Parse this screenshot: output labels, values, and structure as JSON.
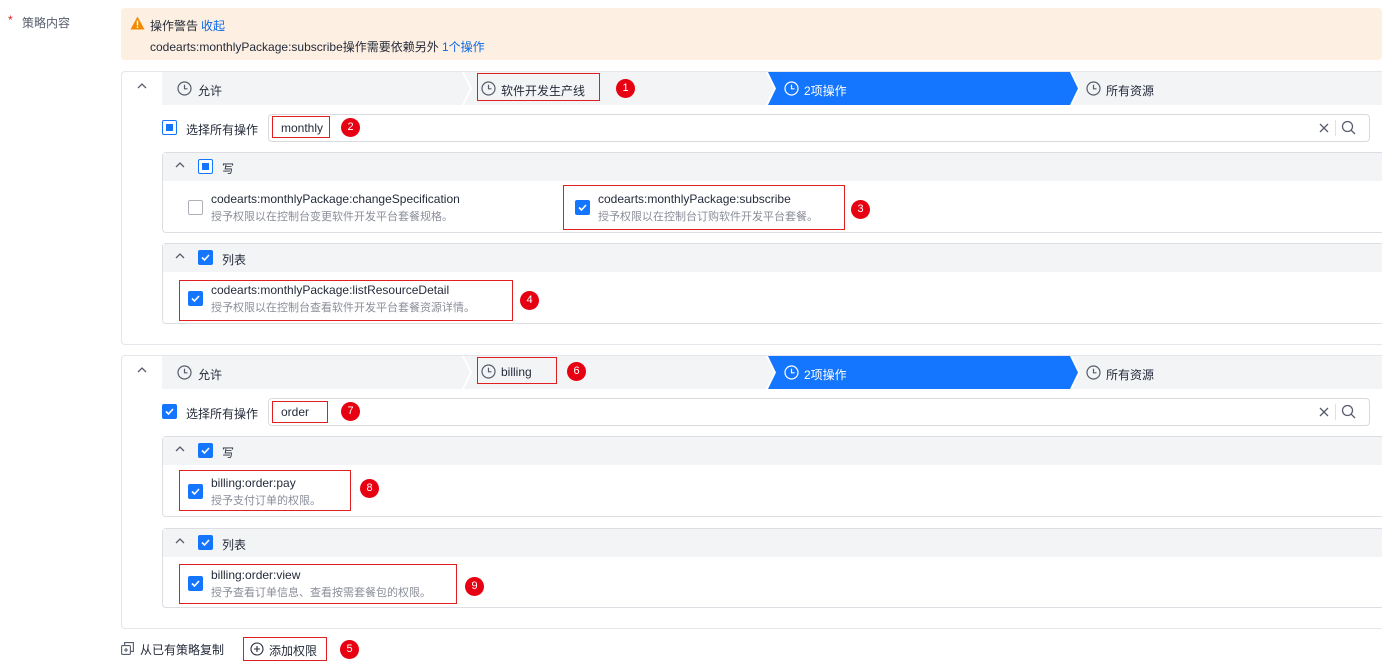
{
  "field": {
    "required_mark": "*",
    "label": "策略内容"
  },
  "warning": {
    "title": "操作警告",
    "collapse_label": "收起",
    "message": "codearts:monthlyPackage:subscribe操作需要依赖另外",
    "link_text": "1个操作",
    "color": "#fdf0e2"
  },
  "statements": [
    {
      "steps": [
        "允许",
        "软件开发生产线",
        "2项操作",
        "所有资源"
      ],
      "step_marker": "1",
      "select_all_label": "选择所有操作",
      "search_value": "monthly",
      "search_marker": "2",
      "groups": [
        {
          "title": "写",
          "items": [
            {
              "name": "codearts:monthlyPackage:changeSpecification",
              "desc": "授予权限以在控制台变更软件开发平台套餐规格。"
            },
            {
              "name": "codearts:monthlyPackage:subscribe",
              "desc": "授予权限以在控制台订购软件开发平台套餐。",
              "marker": "3"
            }
          ]
        },
        {
          "title": "列表",
          "items": [
            {
              "name": "codearts:monthlyPackage:listResourceDetail",
              "desc": "授予权限以在控制台查看软件开发平台套餐资源详情。",
              "marker": "4"
            }
          ]
        }
      ]
    },
    {
      "steps": [
        "允许",
        "billing",
        "2项操作",
        "所有资源"
      ],
      "step_marker": "6",
      "select_all_label": "选择所有操作",
      "search_value": "order",
      "search_marker": "7",
      "groups": [
        {
          "title": "写",
          "items": [
            {
              "name": "billing:order:pay",
              "desc": "授予支付订单的权限。",
              "marker": "8"
            }
          ]
        },
        {
          "title": "列表",
          "items": [
            {
              "name": "billing:order:view",
              "desc": "授予查看订单信息、查看按需套餐包的权限。",
              "marker": "9"
            }
          ]
        }
      ]
    }
  ],
  "footer": {
    "copy_label": "从已有策略复制",
    "add_label": "添加权限",
    "add_marker": "5"
  },
  "colors": {
    "accent": "#1476ff",
    "active_step": "#1476ff",
    "annotation_red": "#e60012"
  },
  "icons": [
    "warning-icon",
    "clock-icon",
    "chevron-up-icon",
    "clear-icon",
    "search-icon",
    "copy-icon",
    "plus-circle-icon"
  ]
}
